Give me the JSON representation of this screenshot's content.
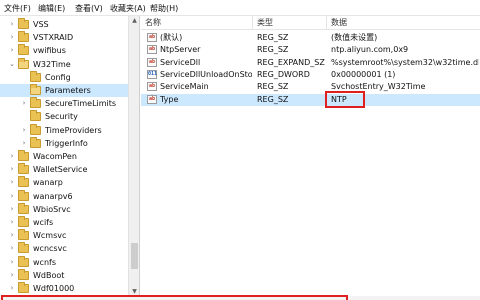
{
  "menu": [
    "文件(F)",
    "编辑(E)",
    "查看(V)",
    "收藏夹(A)",
    "帮助(H)"
  ],
  "tree": [
    {
      "label": "VSS",
      "expander": "›",
      "folder": "closed",
      "selected": false
    },
    {
      "label": "VSTXRAID",
      "expander": "›",
      "folder": "closed",
      "selected": false
    },
    {
      "label": "vwifibus",
      "expander": "›",
      "folder": "closed",
      "selected": false
    },
    {
      "label": "W32Time",
      "expander": "⌄",
      "folder": "open",
      "selected": false
    },
    {
      "label": "Config",
      "expander": "",
      "folder": "closed",
      "selected": false
    },
    {
      "label": "Parameters",
      "expander": "",
      "folder": "open",
      "selected": true
    },
    {
      "label": "SecureTimeLimits",
      "expander": "›",
      "folder": "closed",
      "selected": false
    },
    {
      "label": "Security",
      "expander": "",
      "folder": "closed",
      "selected": false
    },
    {
      "label": "TimeProviders",
      "expander": "›",
      "folder": "closed",
      "selected": false
    },
    {
      "label": "TriggerInfo",
      "expander": "›",
      "folder": "closed",
      "selected": false
    },
    {
      "label": "WacomPen",
      "expander": "›",
      "folder": "closed",
      "selected": false
    },
    {
      "label": "WalletService",
      "expander": "›",
      "folder": "closed",
      "selected": false
    },
    {
      "label": "wanarp",
      "expander": "›",
      "folder": "closed",
      "selected": false
    },
    {
      "label": "wanarpv6",
      "expander": "›",
      "folder": "closed",
      "selected": false
    },
    {
      "label": "WbioSrvc",
      "expander": "›",
      "folder": "closed",
      "selected": false
    },
    {
      "label": "wcifs",
      "expander": "›",
      "folder": "closed",
      "selected": false
    },
    {
      "label": "Wcmsvc",
      "expander": "›",
      "folder": "closed",
      "selected": false
    },
    {
      "label": "wcncsvc",
      "expander": "›",
      "folder": "closed",
      "selected": false
    },
    {
      "label": "wcnfs",
      "expander": "›",
      "folder": "closed",
      "selected": false
    },
    {
      "label": "WdBoot",
      "expander": "›",
      "folder": "closed",
      "selected": false
    },
    {
      "label": "Wdf01000",
      "expander": "›",
      "folder": "closed",
      "selected": false
    }
  ],
  "columns": {
    "name": "名称",
    "type": "类型",
    "data": "数据"
  },
  "values": [
    {
      "name": "(默认)",
      "type": "REG_SZ",
      "data": "(数值未设置)",
      "icon": "ab",
      "selected": false
    },
    {
      "name": "NtpServer",
      "type": "REG_SZ",
      "data": "ntp.aliyun.com,0x9",
      "icon": "ab",
      "selected": false
    },
    {
      "name": "ServiceDll",
      "type": "REG_EXPAND_SZ",
      "data": "%systemroot%\\system32\\w32time.dll",
      "icon": "ab",
      "selected": false
    },
    {
      "name": "ServiceDllUnloadOnStop",
      "type": "REG_DWORD",
      "data": "0x00000001 (1)",
      "icon": "011",
      "selected": false
    },
    {
      "name": "ServiceMain",
      "type": "REG_SZ",
      "data": "SvchostEntry_W32Time",
      "icon": "ab",
      "selected": false
    },
    {
      "name": "Type",
      "type": "REG_SZ",
      "data": "NTP",
      "icon": "ab",
      "selected": true
    }
  ],
  "icons": {
    "string_value": "ab-string-icon",
    "dword_value": "binary-value-icon",
    "folder": "folder-icon"
  },
  "colors": {
    "highlight_box": "#e02020",
    "selection": "#cce8ff",
    "folder": "#e9c253"
  }
}
